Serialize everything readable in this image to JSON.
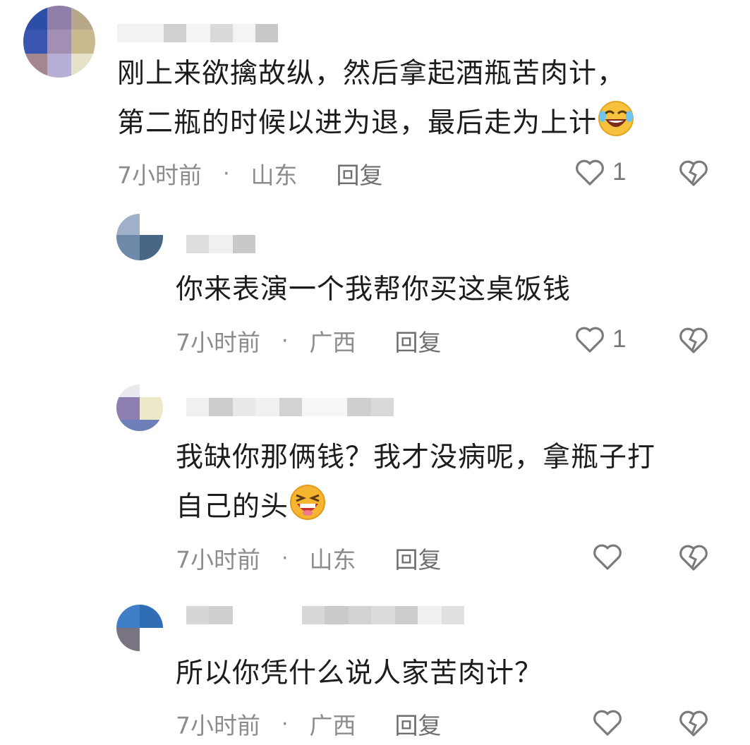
{
  "comments": [
    {
      "text_lines": [
        "刚上来欲擒故纵，然后拿起酒瓶苦肉计，",
        "第二瓶的时候以进为退，最后走为上计"
      ],
      "emoji": "rofl-emoji",
      "time": "7小时前",
      "separator": "·",
      "location": "山东",
      "reply_label": "回复",
      "like_count": "1"
    },
    {
      "text_lines": [
        "你来表演一个我帮你买这桌饭钱"
      ],
      "time": "7小时前",
      "separator": "·",
      "location": "广西",
      "reply_label": "回复",
      "like_count": "1"
    },
    {
      "text_lines": [
        "我缺你那俩钱？我才没病呢，拿瓶子打",
        "自己的头"
      ],
      "emoji": "laughing-emoji",
      "time": "7小时前",
      "separator": "·",
      "location": "山东",
      "reply_label": "回复",
      "like_count": ""
    },
    {
      "text_lines": [
        "所以你凭什么说人家苦肉计？"
      ],
      "time": "7小时前",
      "separator": "·",
      "location": "广西",
      "reply_label": "回复",
      "like_count": ""
    }
  ],
  "colors": {
    "meta_gray": "#8c8c8c",
    "text": "#1c1c1c"
  }
}
